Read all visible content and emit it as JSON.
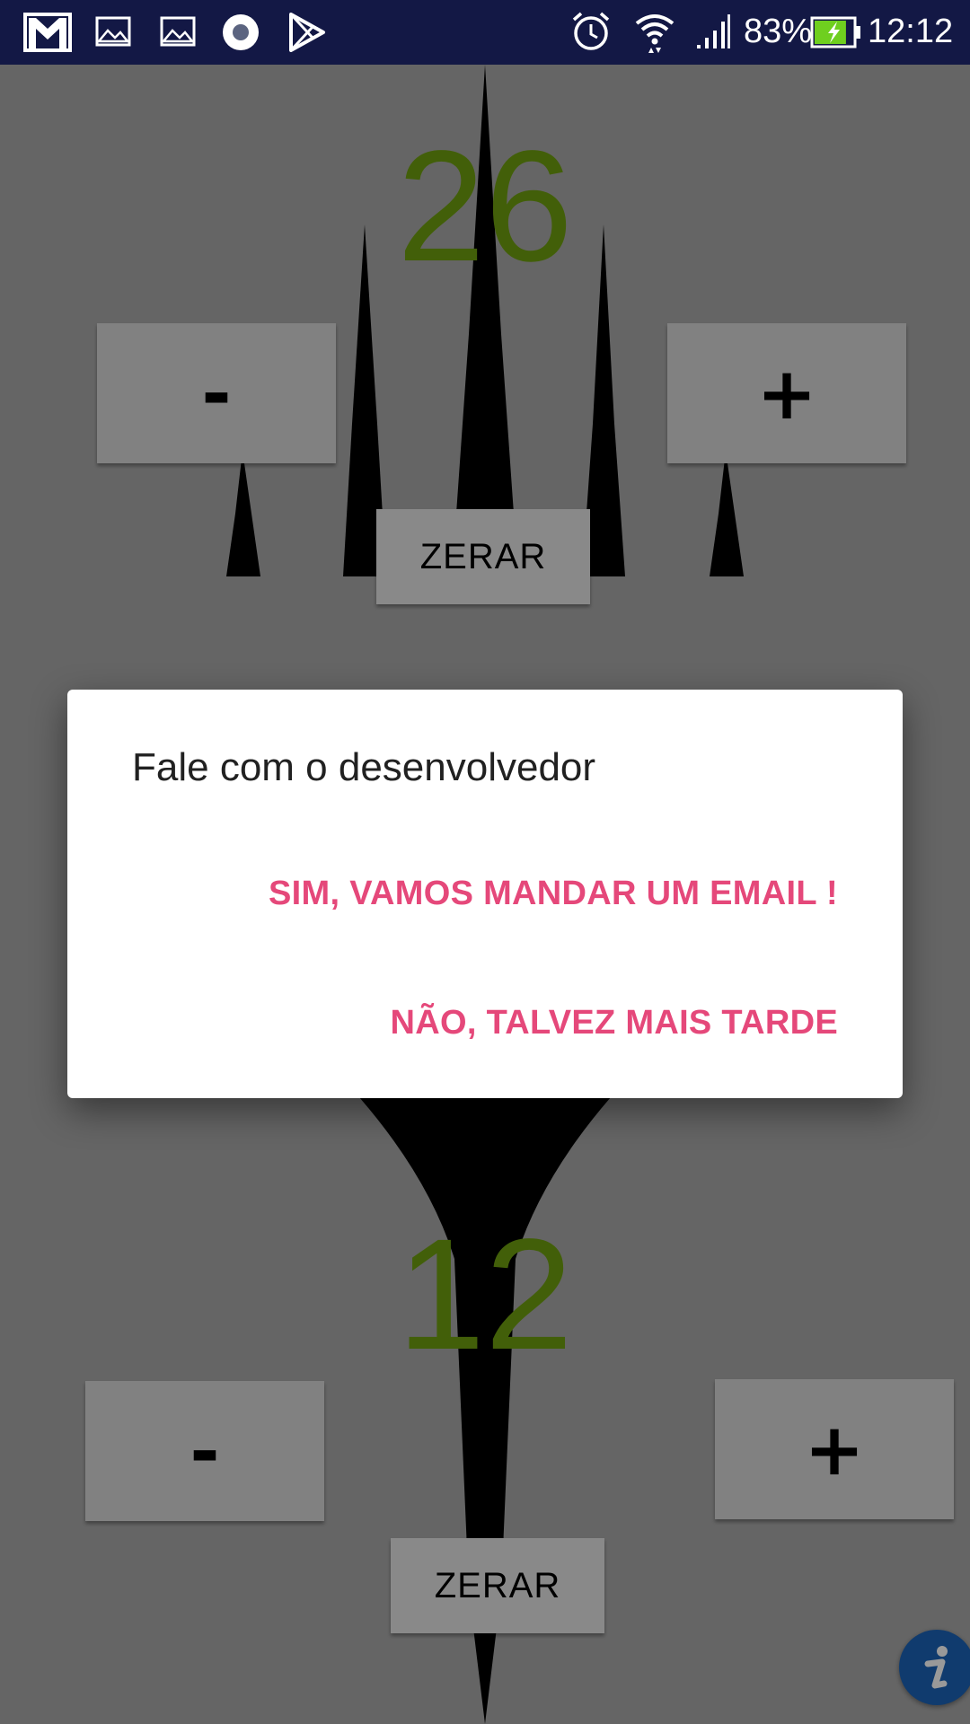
{
  "status_bar": {
    "notification_icons": [
      "gmail-icon",
      "image-icon",
      "image-icon",
      "record-icon",
      "play-store-icon"
    ],
    "system_icons": [
      "alarm-icon",
      "wifi-icon",
      "signal-icon",
      "battery-icon"
    ],
    "battery_percent": "83%",
    "time": "12:12",
    "battery_level": 0.83,
    "colors": {
      "background": "#131845",
      "battery_fill": "#6fcf1f"
    }
  },
  "counter_top": {
    "score": "26",
    "minus_label": "-",
    "plus_label": "+",
    "reset_label": "ZERAR"
  },
  "counter_bottom": {
    "score": "12",
    "minus_label": "-",
    "plus_label": "+",
    "reset_label": "ZERAR"
  },
  "info_button": {
    "icon": "info-icon",
    "color": "#1c63b7"
  },
  "dialog": {
    "title": "Fale com o desenvolvedor",
    "positive_action": "SIM, VAMOS MANDAR UM EMAIL !",
    "negative_action": "NÃO, TALVEZ MAIS TARDE",
    "accent_color": "#e5487a"
  },
  "colors": {
    "score": "#6f9f10",
    "scrim": "rgba(0,0,0,0.40)"
  }
}
